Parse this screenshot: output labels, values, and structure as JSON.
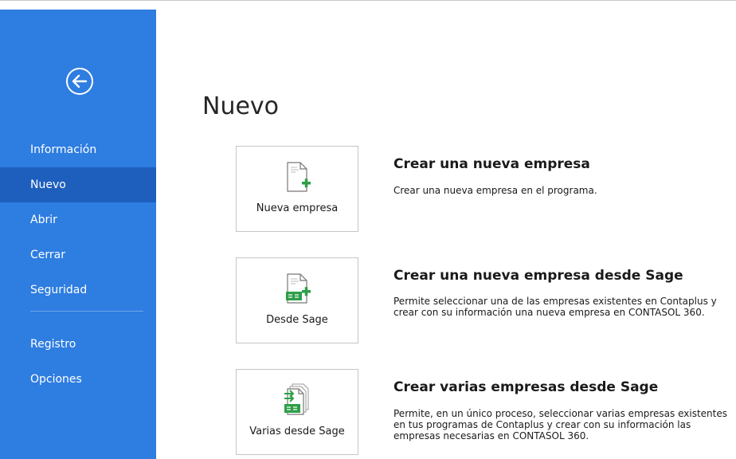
{
  "sidebar": {
    "items": [
      {
        "label": "Información"
      },
      {
        "label": "Nuevo"
      },
      {
        "label": "Abrir"
      },
      {
        "label": "Cerrar"
      },
      {
        "label": "Seguridad"
      },
      {
        "label": "Registro"
      },
      {
        "label": "Opciones"
      }
    ],
    "active": "Nuevo"
  },
  "main": {
    "title": "Nuevo",
    "options": [
      {
        "tile_label": "Nueva empresa",
        "title": "Crear una nueva empresa",
        "description": "Crear una nueva empresa en el programa."
      },
      {
        "tile_label": "Desde Sage",
        "title": "Crear una nueva empresa desde Sage",
        "description": "Permite seleccionar una de las empresas existentes en Contaplus y crear con su información una nueva empresa en CONTASOL 360."
      },
      {
        "tile_label": "Varias desde Sage",
        "title": "Crear varias empresas desde Sage",
        "description": "Permite, en un único proceso, seleccionar varias empresas existentes en tus programas de Contaplus y crear con su información las empresas necesarias en CONTASOL 360."
      }
    ]
  },
  "icons": {
    "back": "back-arrow-icon",
    "new_doc": "new-document-icon",
    "sage_doc": "sage-document-icon",
    "multi_sage_doc": "multi-sage-document-icon"
  },
  "colors": {
    "sidebar_bg": "#2e7de1",
    "sidebar_active": "#1e5fbd",
    "sage_green": "#2e9e48"
  }
}
